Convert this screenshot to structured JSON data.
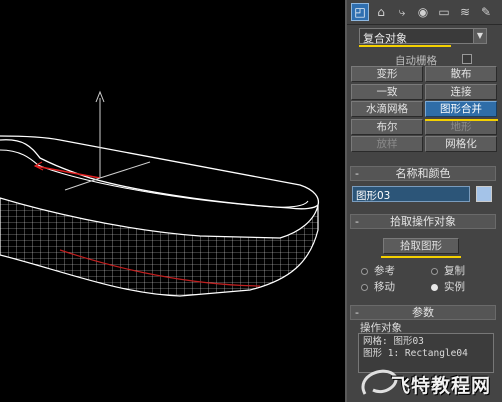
{
  "toolbar": {
    "tabs": [
      {
        "icon": "create-icon",
        "glyph": "◰",
        "active": true
      },
      {
        "icon": "modify-icon",
        "glyph": "⌂",
        "active": false
      },
      {
        "icon": "hierarchy-icon",
        "glyph": "⤷",
        "active": false
      },
      {
        "icon": "motion-icon",
        "glyph": "◉",
        "active": false
      },
      {
        "icon": "display-icon",
        "glyph": "▭",
        "active": false
      },
      {
        "icon": "utilities-icon",
        "glyph": "≋",
        "active": false
      },
      {
        "icon": "more-icon",
        "glyph": "✎",
        "active": false
      }
    ]
  },
  "category_dropdown": {
    "value": "复合对象"
  },
  "object_type": {
    "autogrid_label": "自动栅格",
    "buttons": [
      {
        "label": "变形"
      },
      {
        "label": "散布"
      },
      {
        "label": "一致"
      },
      {
        "label": "连接"
      },
      {
        "label": "水滴网格"
      },
      {
        "label": "图形合并"
      },
      {
        "label": "布尔"
      },
      {
        "label": "地形"
      },
      {
        "label": "放样"
      },
      {
        "label": "网格化"
      }
    ]
  },
  "name_color": {
    "title": "名称和颜色",
    "name_value": "图形03",
    "swatch_color": "#a4c3e8"
  },
  "pick_operand": {
    "title": "拾取操作对象",
    "pick_button": "拾取图形",
    "radios": [
      {
        "label": "参考",
        "on": false
      },
      {
        "label": "复制",
        "on": false
      },
      {
        "label": "移动",
        "on": false
      },
      {
        "label": "实例",
        "on": true
      }
    ]
  },
  "parameters": {
    "title": "参数",
    "operands_label": "操作对象",
    "list": [
      "网格: 图形03",
      "图形 1: Rectangle04"
    ]
  },
  "collapse_symbol": "-",
  "watermark": "飞特教程网",
  "accent_color": "#f4d000"
}
